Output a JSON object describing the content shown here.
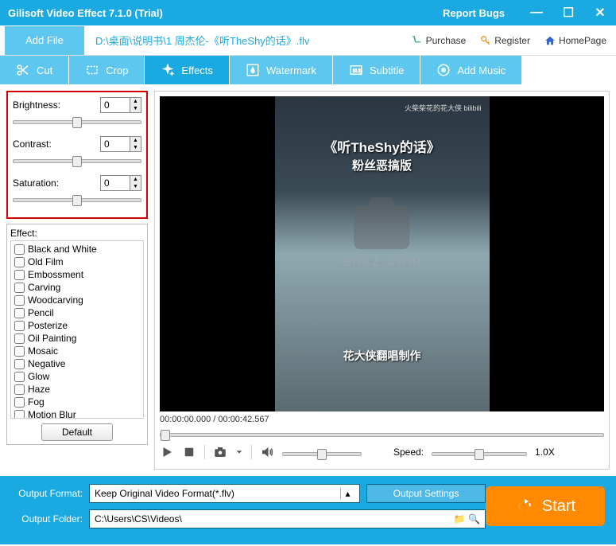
{
  "titlebar": {
    "title": "Gilisoft Video Effect 7.1.0 (Trial)",
    "report": "Report Bugs"
  },
  "toolbar": {
    "add_file": "Add File",
    "file_path": "D:\\桌面\\说明书\\1 周杰伦-《听TheShy的话》.flv",
    "links": {
      "purchase": "Purchase",
      "register": "Register",
      "homepage": "HomePage"
    }
  },
  "tabs": {
    "cut": "Cut",
    "crop": "Crop",
    "effects": "Effects",
    "watermark": "Watermark",
    "subtitle": "Subtitle",
    "add_music": "Add Music"
  },
  "adjust": {
    "brightness": {
      "label": "Brightness:",
      "value": "0"
    },
    "contrast": {
      "label": "Contrast:",
      "value": "0"
    },
    "saturation": {
      "label": "Saturation:",
      "value": "0"
    }
  },
  "effects_panel": {
    "title": "Effect:",
    "items": [
      "Black and White",
      "Old Film",
      "Embossment",
      "Carving",
      "Woodcarving",
      "Pencil",
      "Posterize",
      "Oil Painting",
      "Mosaic",
      "Negative",
      "Glow",
      "Haze",
      "Fog",
      "Motion Blur"
    ],
    "default_btn": "Default"
  },
  "video": {
    "overlay1": "《听TheShy的话》",
    "overlay2": "粉丝恶搞版",
    "overlay3": "花大侠翻唱制作",
    "watermark": "anxz.com",
    "bili": "火柴柴花的花大侠  bilibili",
    "time": "00:00:00.000 / 00:00:42.567",
    "speed_label": "Speed:",
    "speed_value": "1.0X"
  },
  "output": {
    "format_label": "Output Format:",
    "format_value": "Keep Original Video Format(*.flv)",
    "settings_btn": "Output Settings",
    "folder_label": "Output Folder:",
    "folder_value": "C:\\Users\\CS\\Videos\\",
    "start": "Start"
  }
}
